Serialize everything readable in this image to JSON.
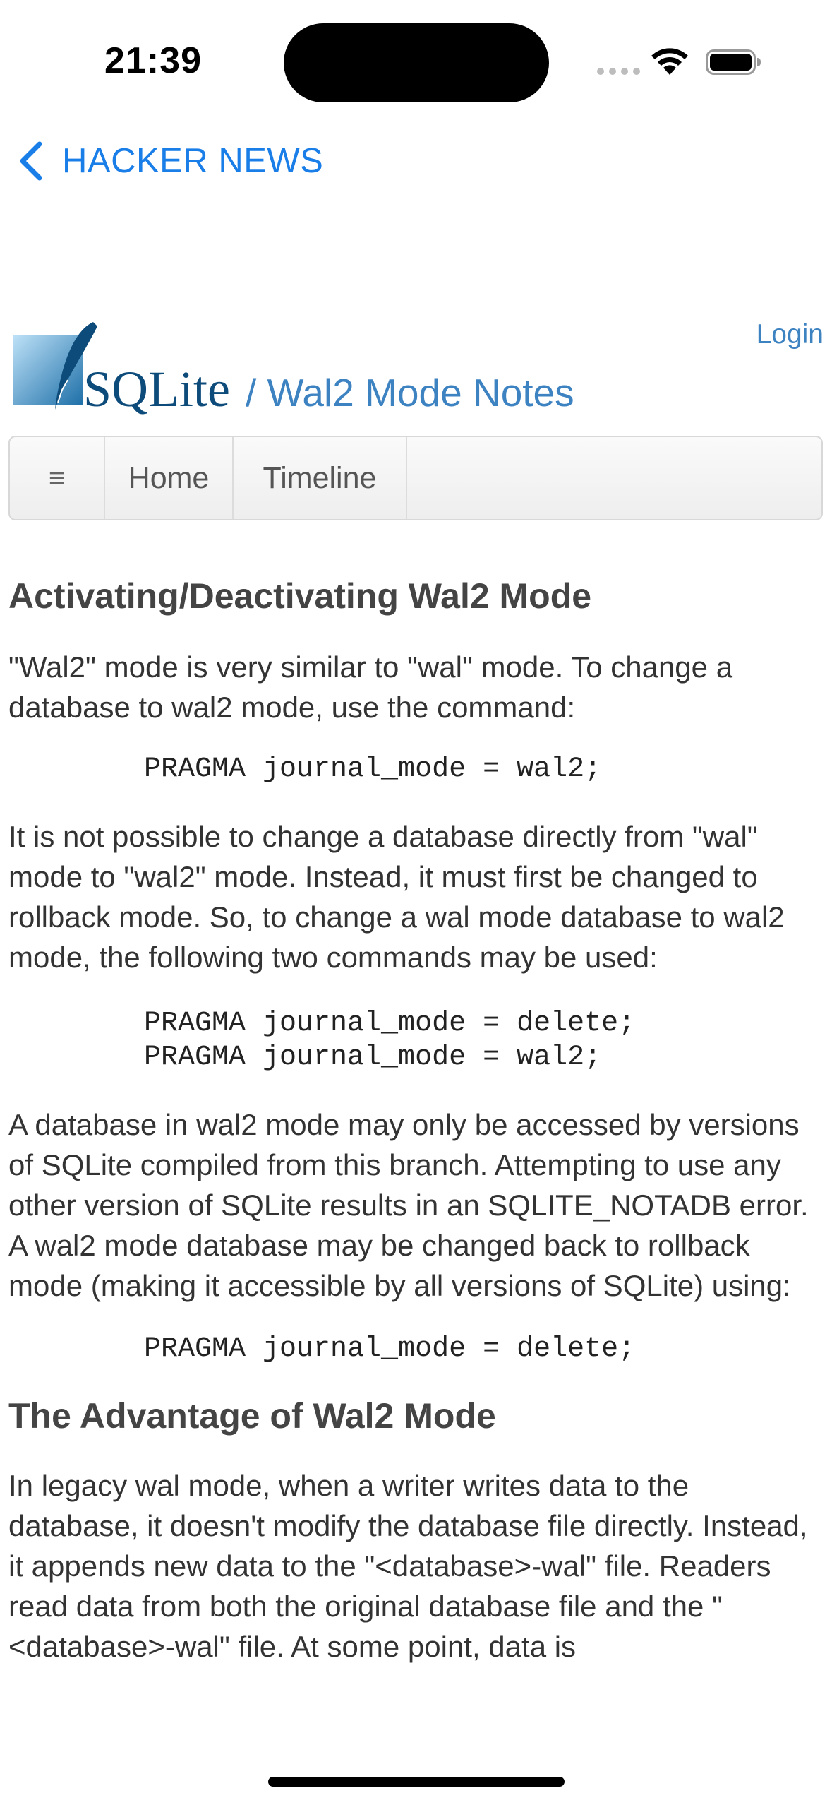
{
  "status_bar": {
    "time": "21:39"
  },
  "nav": {
    "back_label": "HACKER NEWS"
  },
  "header": {
    "logo_text": "SQLite",
    "title": "/ Wal2 Mode Notes",
    "login": "Login"
  },
  "menu": {
    "hamburger": "≡",
    "items": [
      {
        "label": "Home"
      },
      {
        "label": "Timeline"
      }
    ]
  },
  "article": {
    "heading1": "Activating/Deactivating Wal2 Mode",
    "para1": "\"Wal2\" mode is very similar to \"wal\" mode. To change a database to wal2 mode, use the command:",
    "code1": "PRAGMA journal_mode = wal2;",
    "para2": "It is not possible to change a database directly from \"wal\" mode to \"wal2\" mode. Instead, it must first be changed to rollback mode. So, to change a wal mode database to wal2 mode, the following two commands may be used:",
    "code2": "PRAGMA journal_mode = delete;\nPRAGMA journal_mode = wal2;",
    "para3": "A database in wal2 mode may only be accessed by versions of SQLite compiled from this branch. Attempting to use any other version of SQLite results in an SQLITE_NOTADB error. A wal2 mode database may be changed back to rollback mode (making it accessible by all versions of SQLite) using:",
    "code3": "PRAGMA journal_mode = delete;",
    "heading2": "The Advantage of Wal2 Mode",
    "para4": "In legacy wal mode, when a writer writes data to the database, it doesn't modify the database file directly. Instead, it appends new data to the \"<database>-wal\" file. Readers read data from both the original database file and the \"<database>-wal\" file. At some point, data is"
  },
  "icons": {
    "back": "chevron-left-icon",
    "signal": "cellular-signal-icon",
    "wifi": "wifi-icon",
    "battery": "battery-icon",
    "logo": "sqlite-feather-logo"
  },
  "colors": {
    "ios_link": "#1a7ee8",
    "site_link": "#3d82c1",
    "logo_blue": "#0d4b7a"
  }
}
